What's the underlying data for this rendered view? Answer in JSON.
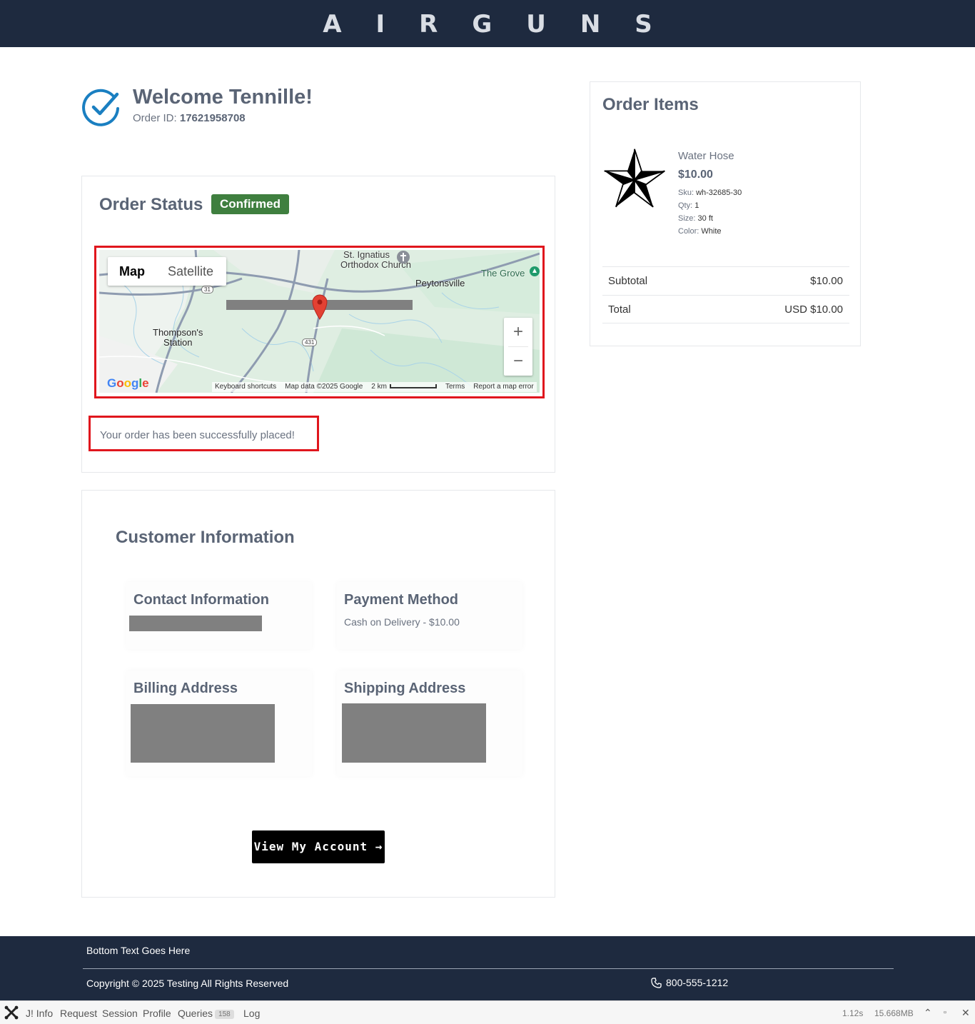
{
  "header": {
    "brand": "AIRGUNS"
  },
  "welcome": {
    "title": "Welcome Tennille!",
    "order_id_label": "Order ID:",
    "order_id": "17621958708"
  },
  "order_status": {
    "title": "Order Status",
    "badge": "Confirmed",
    "badge_color": "#3f7f3f",
    "success_message": "Your order has been successfully placed!"
  },
  "map": {
    "tab_map": "Map",
    "tab_satellite": "Satellite",
    "places": {
      "church_line1": "St. Ignatius",
      "church_line2": "Orthodox Church",
      "peytonsville": "Peytonsville",
      "the_grove": "The Grove",
      "thompsons_line1": "Thompson's",
      "thompsons_line2": "Station",
      "route_31": "31",
      "route_431": "431"
    },
    "zoom_in": "+",
    "zoom_out": "−",
    "google": "Google",
    "footer": {
      "shortcuts": "Keyboard shortcuts",
      "map_data": "Map data ©2025 Google",
      "scale": "2 km",
      "terms": "Terms",
      "report": "Report a map error"
    }
  },
  "customer": {
    "title": "Customer Information",
    "contact_title": "Contact Information",
    "payment_title": "Payment Method",
    "payment_value": "Cash on Delivery - $10.00",
    "billing_title": "Billing Address",
    "shipping_title": "Shipping Address",
    "account_button": "View My Account →"
  },
  "order_items": {
    "title": "Order Items",
    "items": [
      {
        "icon": "star-icon",
        "name": "Water Hose",
        "price": "$10.00",
        "sku_label": "Sku:",
        "sku": "wh-32685-30",
        "qty_label": "Qty:",
        "qty": "1",
        "size_label": "Size:",
        "size": "30 ft",
        "color_label": "Color:",
        "color": "White"
      }
    ],
    "subtotal_label": "Subtotal",
    "subtotal": "$10.00",
    "total_label": "Total",
    "total": "USD $10.00"
  },
  "footer": {
    "top_text": "Bottom Text Goes Here",
    "copyright": "Copyright © 2025 Testing All Rights Reserved",
    "phone": "800-555-1212"
  },
  "debugbar": {
    "items": [
      "J! Info",
      "Request",
      "Session",
      "Profile",
      "Queries",
      "Log"
    ],
    "queries_count": "158",
    "time": "1.12s",
    "memory": "15.668MB"
  },
  "colors": {
    "navy": "#1e2a3f",
    "accent_blue": "#1a7fc1",
    "highlight_red": "#e0161d"
  }
}
